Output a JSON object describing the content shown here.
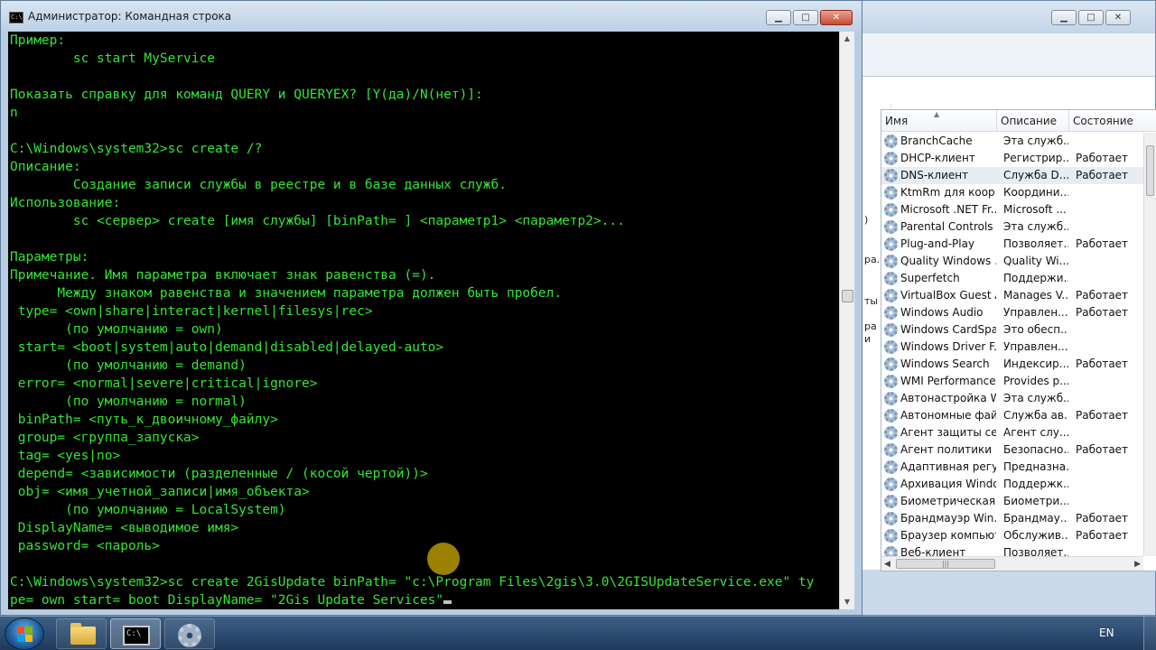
{
  "cmd_window": {
    "title": "Администратор: Командная строка",
    "icon_glyph": "C:\\",
    "controls": {
      "minimize": "▁",
      "maximize": "□",
      "close": "✕"
    },
    "lines": [
      "Пример:",
      "        sc start MyService",
      "",
      "Показать справку для команд QUERY и QUERYEX? [Y(да)/N(нет)]:",
      "n",
      "",
      "C:\\Windows\\system32>sc create /?",
      "Описание:",
      "        Создание записи службы в реестре и в базе данных служб.",
      "Использование:",
      "        sc <сервер> create [имя службы] [binPath= ] <параметр1> <параметр2>...",
      "",
      "Параметры:",
      "Примечание. Имя параметра включает знак равенства (=).",
      "      Между знаком равенства и значением параметра должен быть пробел.",
      " type= <own|share|interact|kernel|filesys|rec>",
      "       (по умолчанию = own)",
      " start= <boot|system|auto|demand|disabled|delayed-auto>",
      "       (по умолчанию = demand)",
      " error= <normal|severe|critical|ignore>",
      "       (по умолчанию = normal)",
      " binPath= <путь_к_двоичному_файлу>",
      " group= <группа_запуска>",
      " tag= <yes|no>",
      " depend= <зависимости (разделенные / (косой чертой))>",
      " obj= <имя_учетной_записи|имя_объекта>",
      "       (по умолчанию = LocalSystem)",
      " DisplayName= <выводимое имя>",
      " password= <пароль>",
      "",
      "C:\\Windows\\system32>sc create 2GisUpdate binPath= \"c:\\Program Files\\2gis\\3.0\\2GISUpdateService.exe\" ty",
      "pe= own start= boot DisplayName= \"2Gis Update Services\""
    ]
  },
  "services_window": {
    "controls": {
      "minimize": "▁",
      "maximize": "□",
      "close": "✕"
    },
    "left_strip": [
      ")",
      "ра.",
      "ты",
      "ра",
      "и"
    ],
    "columns": {
      "name": "Имя",
      "description": "Описание",
      "status": "Состояние"
    },
    "sort_indicator": "▲",
    "rows": [
      {
        "name": "BranchCache",
        "description": "Эта служб...",
        "status": ""
      },
      {
        "name": "DHCP-клиент",
        "description": "Регистрир...",
        "status": "Работает"
      },
      {
        "name": "DNS-клиент",
        "description": "Служба D...",
        "status": "Работает"
      },
      {
        "name": "KtmRm для коор...",
        "description": "Координи...",
        "status": ""
      },
      {
        "name": "Microsoft .NET Fr...",
        "description": "Microsoft ...",
        "status": ""
      },
      {
        "name": "Parental Controls",
        "description": "Эта служб...",
        "status": ""
      },
      {
        "name": "Plug-and-Play",
        "description": "Позволяет...",
        "status": "Работает"
      },
      {
        "name": "Quality Windows ...",
        "description": "Quality Wi...",
        "status": ""
      },
      {
        "name": "Superfetch",
        "description": "Поддержи...",
        "status": ""
      },
      {
        "name": "VirtualBox Guest A...",
        "description": "Manages V...",
        "status": "Работает"
      },
      {
        "name": "Windows Audio",
        "description": "Управлен...",
        "status": "Работает"
      },
      {
        "name": "Windows CardSpa...",
        "description": "Это обесп...",
        "status": ""
      },
      {
        "name": "Windows Driver F...",
        "description": "Управлен...",
        "status": ""
      },
      {
        "name": "Windows Search",
        "description": "Индексир...",
        "status": "Работает"
      },
      {
        "name": "WMI Performance...",
        "description": "Provides p...",
        "status": ""
      },
      {
        "name": "Автонастройка W...",
        "description": "Эта служб...",
        "status": ""
      },
      {
        "name": "Автономные фай...",
        "description": "Служба ав...",
        "status": "Работает"
      },
      {
        "name": "Агент защиты сет...",
        "description": "Агент слу...",
        "status": ""
      },
      {
        "name": "Агент политики I...",
        "description": "Безопасно...",
        "status": "Работает"
      },
      {
        "name": "Адаптивная регу...",
        "description": "Предназна...",
        "status": ""
      },
      {
        "name": "Архивация Windo...",
        "description": "Поддержк...",
        "status": ""
      },
      {
        "name": "Биометрическая ...",
        "description": "Биометри...",
        "status": ""
      },
      {
        "name": "Брандмауэр Win...",
        "description": "Брандмау...",
        "status": "Работает"
      },
      {
        "name": "Браузер компьют...",
        "description": "Обслужив...",
        "status": "Работает"
      },
      {
        "name": "Веб-клиент",
        "description": "Позволяет...",
        "status": ""
      }
    ],
    "selected_row": "DNS-клиент"
  },
  "taskbar": {
    "language": "EN"
  },
  "colors": {
    "console_text": "#34e534",
    "console_bg": "#000000",
    "titlebar": "#c9d9ea"
  }
}
